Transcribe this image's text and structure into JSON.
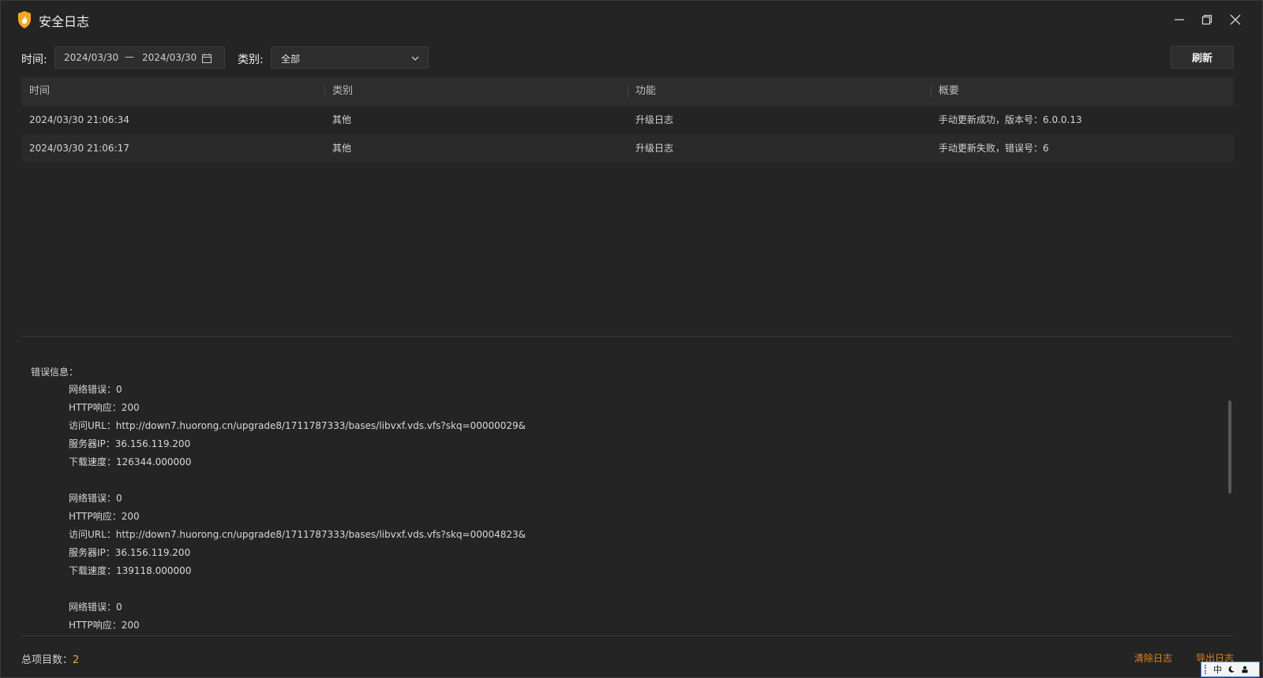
{
  "window": {
    "title": "安全日志",
    "accent_color": "#f5a623",
    "link_color": "#e8821e"
  },
  "filters": {
    "time_label": "时间:",
    "date_start": "2024/03/30",
    "date_separator": "—",
    "date_end": "2024/03/30",
    "category_label": "类别:",
    "category_value": "全部",
    "refresh_label": "刷新"
  },
  "table": {
    "columns": [
      "时间",
      "类别",
      "功能",
      "概要"
    ],
    "rows": [
      [
        "2024/03/30 21:06:34",
        "其他",
        "升级日志",
        "手动更新成功，版本号：6.0.0.13"
      ],
      [
        "2024/03/30 21:06:17",
        "其他",
        "升级日志",
        "手动更新失败，错误号：6"
      ]
    ]
  },
  "detail": {
    "title": "错误信息：",
    "lines": [
      "网络错误：0",
      "HTTP响应：200",
      "访问URL：http://down7.huorong.cn/upgrade8/1711787333/bases/libvxf.vds.vfs?skq=00000029&",
      "服务器IP：36.156.119.200",
      "下载速度：126344.000000",
      "",
      "网络错误：0",
      "HTTP响应：200",
      "访问URL：http://down7.huorong.cn/upgrade8/1711787333/bases/libvxf.vds.vfs?skq=00004823&",
      "服务器IP：36.156.119.200",
      "下载速度：139118.000000",
      "",
      "网络错误：0",
      "HTTP响应：200"
    ]
  },
  "footer": {
    "total_label": "总项目数：",
    "total_count": "2",
    "clear_label": "清除日志",
    "export_label": "导出日志"
  },
  "ime": {
    "mode": "中"
  }
}
